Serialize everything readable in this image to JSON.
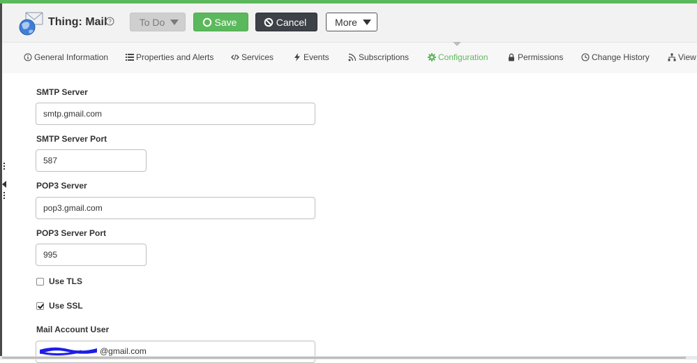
{
  "header": {
    "title": "Thing: Mail",
    "buttons": {
      "todo": "To Do",
      "save": "Save",
      "cancel": "Cancel",
      "more": "More"
    }
  },
  "tabs": [
    {
      "label": "General Information",
      "icon": "info-icon"
    },
    {
      "label": "Properties and Alerts",
      "icon": "list-icon"
    },
    {
      "label": "Services",
      "icon": "code-icon"
    },
    {
      "label": "Events",
      "icon": "lightning-icon"
    },
    {
      "label": "Subscriptions",
      "icon": "rss-icon"
    },
    {
      "label": "Configuration",
      "icon": "gear-icon",
      "active": true
    },
    {
      "label": "Permissions",
      "icon": "lock-icon"
    },
    {
      "label": "Change History",
      "icon": "clock-icon"
    },
    {
      "label": "View",
      "icon": "hierarchy-icon"
    }
  ],
  "form": {
    "smtp_server": {
      "label": "SMTP Server",
      "value": "smtp.gmail.com"
    },
    "smtp_port": {
      "label": "SMTP Server Port",
      "value": "587"
    },
    "pop3_server": {
      "label": "POP3 Server",
      "value": "pop3.gmail.com"
    },
    "pop3_port": {
      "label": "POP3 Server Port",
      "value": "995"
    },
    "use_tls": {
      "label": "Use TLS",
      "checked": false
    },
    "use_ssl": {
      "label": "Use SSL",
      "checked": true
    },
    "mail_user": {
      "label": "Mail Account User",
      "value_suffix": "@gmail.com"
    }
  },
  "colors": {
    "accent": "#5cb85c",
    "dark_button": "#3c4247",
    "disabled_button": "#cfcfcf",
    "redaction": "#1e1ee6",
    "highlight": "#f2ee2e"
  }
}
